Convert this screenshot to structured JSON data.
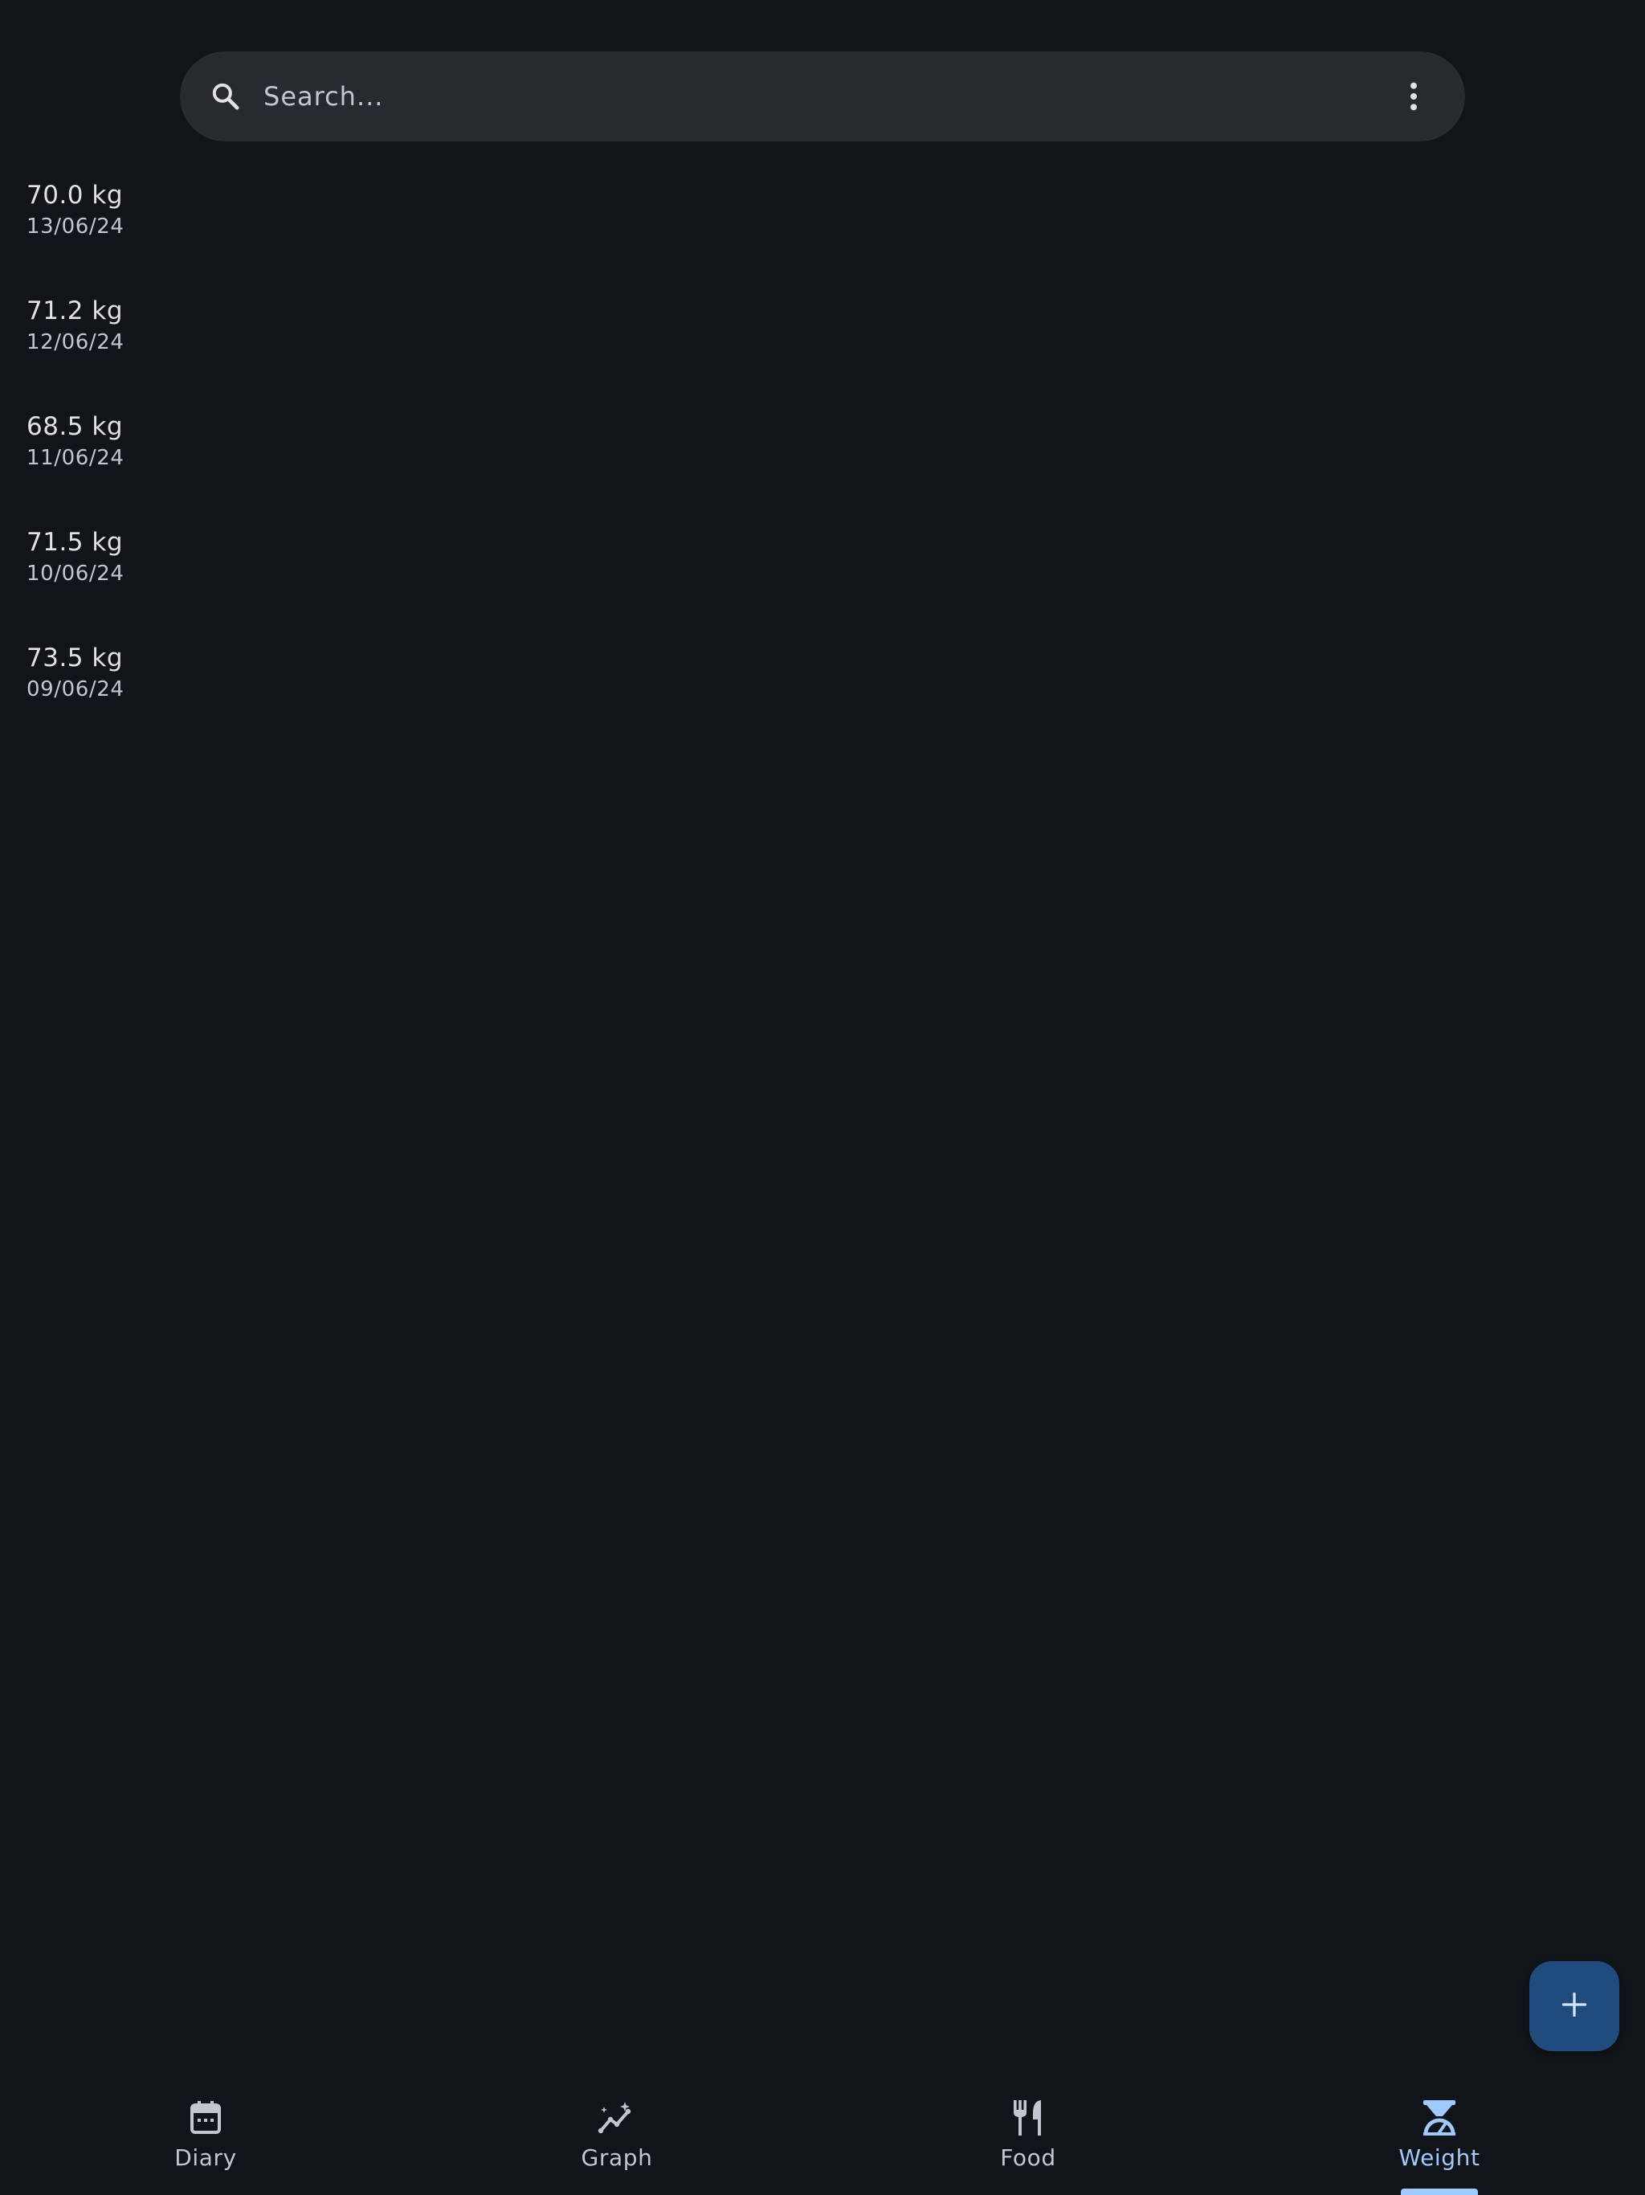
{
  "search": {
    "placeholder": "Search..."
  },
  "weights": [
    {
      "value": "70.0 kg",
      "date": "13/06/24"
    },
    {
      "value": "71.2 kg",
      "date": "12/06/24"
    },
    {
      "value": "68.5 kg",
      "date": "11/06/24"
    },
    {
      "value": "71.5 kg",
      "date": "10/06/24"
    },
    {
      "value": "73.5 kg",
      "date": "09/06/24"
    }
  ],
  "fab": {
    "icon": "plus-icon"
  },
  "nav": {
    "items": [
      {
        "label": "Diary",
        "icon": "calendar-icon",
        "active": false
      },
      {
        "label": "Graph",
        "icon": "graph-icon",
        "active": false
      },
      {
        "label": "Food",
        "icon": "fork-knife-icon",
        "active": false
      },
      {
        "label": "Weight",
        "icon": "scale-icon",
        "active": true
      }
    ]
  },
  "colors": {
    "background": "#111419",
    "search_bar": "#272a2f",
    "fab": "#1f4c7d",
    "accent": "#a0caff",
    "text_primary": "#e1e2e8",
    "text_secondary": "#c4c6cf"
  }
}
